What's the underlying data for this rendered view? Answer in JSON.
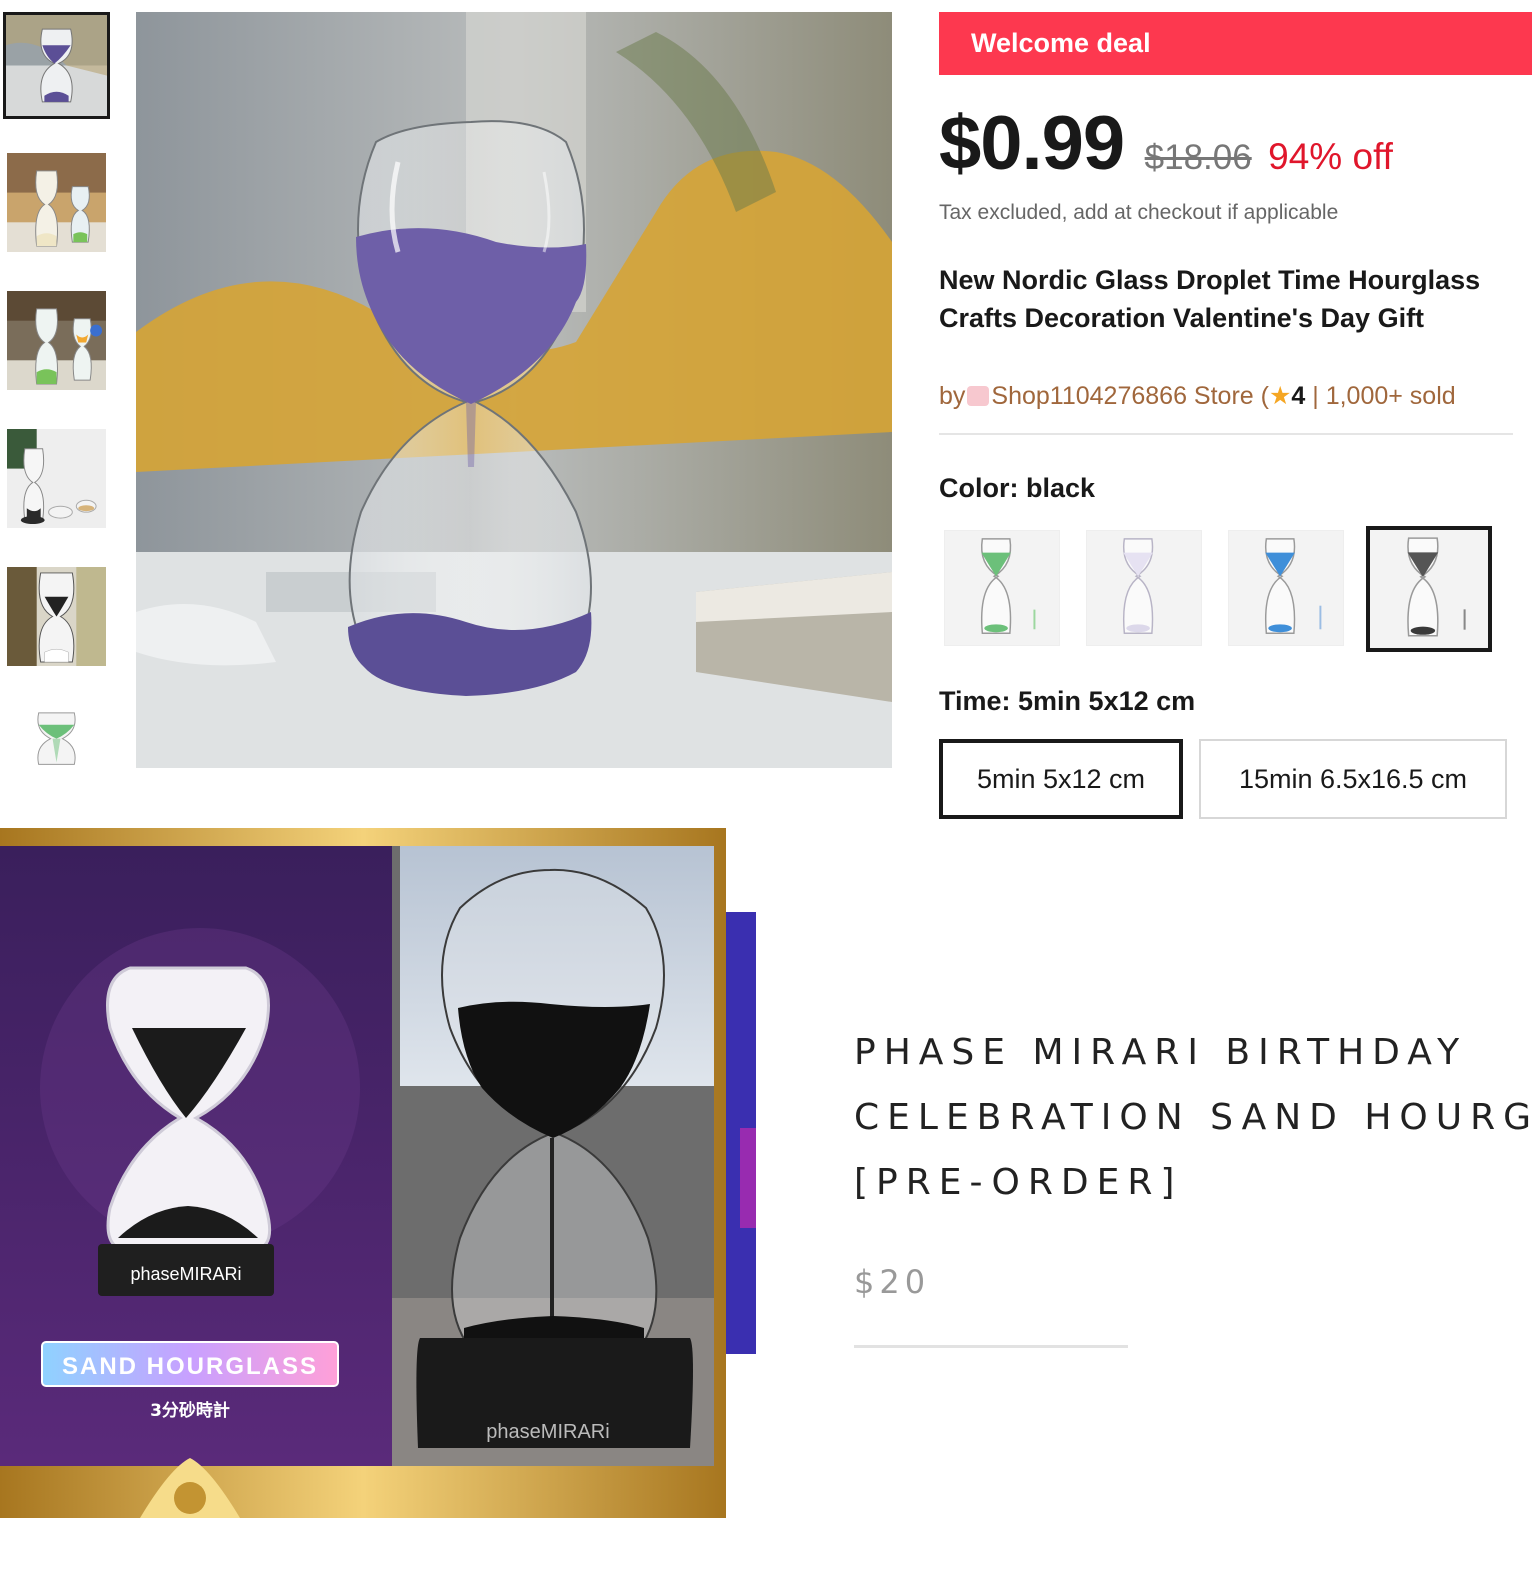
{
  "thumbnails": [
    {
      "name": "thumb-purple-hourglass",
      "sand_color": "#5b4f96"
    },
    {
      "name": "thumb-white-hourglass",
      "sand_color": "#f2efe2"
    },
    {
      "name": "thumb-green-hourglass",
      "sand_color": "#79c35a"
    },
    {
      "name": "thumb-black-hourglass",
      "sand_color": "#2a2a2a"
    },
    {
      "name": "thumb-black-white-hourglass",
      "sand_color": "#222222"
    },
    {
      "name": "thumb-green-small",
      "sand_color": "#6cc07a"
    }
  ],
  "product": {
    "welcome_deal": "Welcome deal",
    "price": "$0.99",
    "original_price": "$18.06",
    "discount": "94% off",
    "tax_note": "Tax excluded, add at checkout if applicable",
    "title_line1": "New Nordic Glass Droplet Time Hourglass",
    "title_line2": "Crafts Decoration Valentine's Day Gift",
    "store_by": "by",
    "store_name": "Shop1104276866 Store",
    "store_open_paren": "(",
    "rating": "4",
    "sold": "| 1,000+ sold",
    "color_label": "Color: black",
    "color_options": [
      {
        "name": "green",
        "sand": "#6cc07a",
        "selected": false
      },
      {
        "name": "white",
        "sand": "#e6e2f2",
        "selected": false
      },
      {
        "name": "blue",
        "sand": "#3f8fd9",
        "selected": false
      },
      {
        "name": "black",
        "sand": "#3a3a3a",
        "selected": true
      }
    ],
    "time_label": "Time: 5min 5x12 cm",
    "time_options": [
      {
        "label": "5min 5x12 cm",
        "selected": true
      },
      {
        "label": "15min 6.5x16.5 cm",
        "selected": false
      }
    ]
  },
  "promo": {
    "badge": "SAND HOURGLASS",
    "subtitle": "3分砂時計",
    "brand": "phaseMIRARi"
  },
  "mirari": {
    "title_line1": "PHASE MIRARI BIRTHDAY",
    "title_line2": "CELEBRATION SAND HOURGLASS",
    "title_line3": "[PRE-ORDER]",
    "price": "$20"
  },
  "colors": {
    "deal_red": "#fd384f",
    "discount_red": "#e0162b",
    "store_brown": "#a0673c",
    "star_gold": "#f5a623"
  }
}
